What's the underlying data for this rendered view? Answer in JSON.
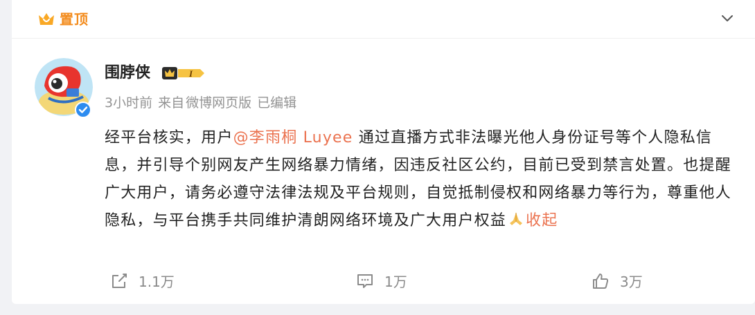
{
  "pin": {
    "label": "置顶",
    "icon": "crown-icon",
    "accent": "#f38b1c"
  },
  "author": {
    "name": "围脖侠",
    "level_badge": "I",
    "verified": true
  },
  "meta": {
    "time": "3小时前",
    "source_prefix": "来自",
    "source": "微博网页版",
    "edited": "已编辑"
  },
  "post": {
    "text_before": "经平台核实，用户",
    "mention": "@李雨桐 Luyee",
    "text_after": " 通过直播方式非法曝光他人身份证号等个人隐私信息，并引导个别网友产生网络暴力情绪，因违反社区公约，目前已受到禁言处置。也提醒广大用户，请务必遵守法律法规及平台规则，自觉抵制侵权和网络暴力等行为，尊重他人隐私，与平台携手共同维护清朗网络环境及广大用户权益",
    "emoji": "pray-hands-icon",
    "collapse": "收起",
    "link_color": "#eb7350"
  },
  "actions": {
    "share_count": "1.1万",
    "comment_count": "1万",
    "like_count": "3万"
  }
}
